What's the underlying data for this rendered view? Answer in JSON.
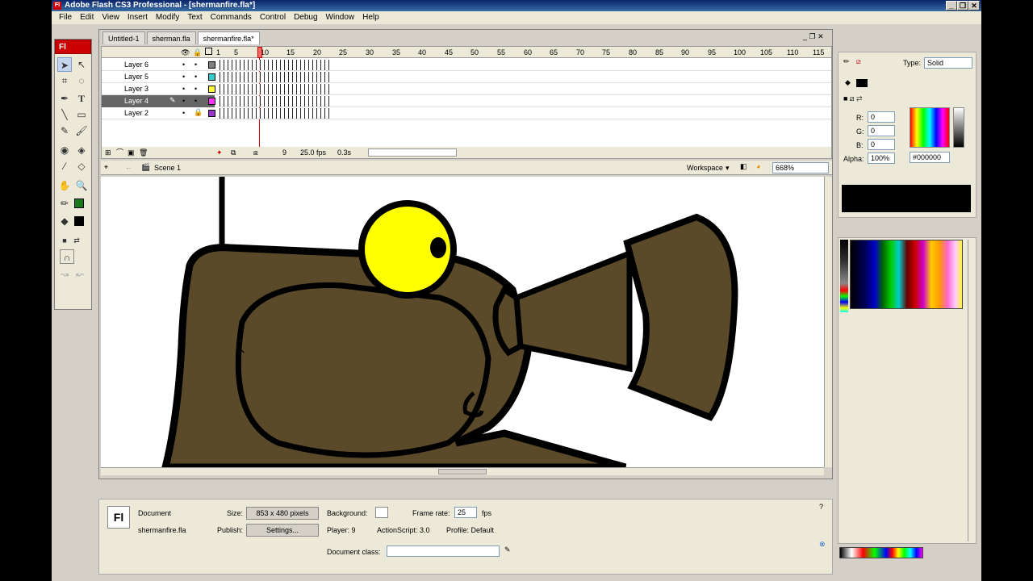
{
  "window": {
    "title": "Adobe Flash CS3 Professional - [shermanfire.fla*]",
    "app_icon": "Fl",
    "controls": [
      "_",
      "❐",
      "✕"
    ]
  },
  "menu": [
    "File",
    "Edit",
    "View",
    "Insert",
    "Modify",
    "Text",
    "Commands",
    "Control",
    "Debug",
    "Window",
    "Help"
  ],
  "toolbox": {
    "header": "Fl"
  },
  "tabs": [
    {
      "label": "Untitled-1",
      "active": false
    },
    {
      "label": "sherman.fla",
      "active": false
    },
    {
      "label": "shermanfire.fla*",
      "active": true
    }
  ],
  "timeline": {
    "ruler": [
      "1",
      "5",
      "10",
      "15",
      "20",
      "25",
      "30",
      "35",
      "40",
      "45",
      "50",
      "55",
      "60",
      "65",
      "70",
      "75",
      "80",
      "85",
      "90",
      "95",
      "100",
      "105",
      "110",
      "115"
    ],
    "layers": [
      {
        "name": "Layer 6",
        "color": "#808080",
        "selected": false,
        "locked": false
      },
      {
        "name": "Layer 5",
        "color": "#33cccc",
        "selected": false,
        "locked": false
      },
      {
        "name": "Layer 3",
        "color": "#ffff33",
        "selected": false,
        "locked": false
      },
      {
        "name": "Layer 4",
        "color": "#ff33ff",
        "selected": true,
        "locked": false
      },
      {
        "name": "Layer 2",
        "color": "#9933cc",
        "selected": false,
        "locked": true
      }
    ],
    "current_frame": "9",
    "fps": "25.0 fps",
    "time": "0.3s"
  },
  "edit_bar": {
    "scene": "Scene 1",
    "workspace": "Workspace",
    "zoom": "668%"
  },
  "properties": {
    "doc_label": "Document",
    "doc_name": "shermanfire.fla",
    "size_label": "Size:",
    "size_value": "853 x 480 pixels",
    "publish_label": "Publish:",
    "settings_btn": "Settings...",
    "background_label": "Background:",
    "framerate_label": "Frame rate:",
    "framerate_value": "25",
    "fps_unit": "fps",
    "player": "Player:  9",
    "actionscript": "ActionScript:  3.0",
    "profile": "Profile:  Default",
    "docclass_label": "Document class:"
  },
  "color_panel": {
    "type_label": "Type:",
    "type_value": "Solid",
    "r_label": "R:",
    "r": "0",
    "g_label": "G:",
    "g": "0",
    "b_label": "B:",
    "b": "0",
    "alpha_label": "Alpha:",
    "alpha": "100%",
    "hex": "#000000",
    "preview_color": "#000000"
  },
  "colors": {
    "tank_body": "#5a4a2a",
    "eye_yellow": "#ffff00",
    "stroke": "#000000",
    "stage_bg": "#ffffff",
    "panel_bg": "#ece9d8"
  }
}
